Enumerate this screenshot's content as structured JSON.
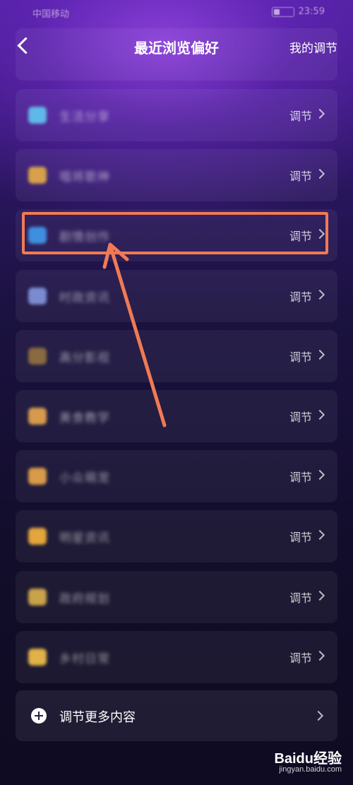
{
  "status_bar": {
    "carrier": "中国移动",
    "time": "23:59"
  },
  "header": {
    "title": "最近浏览偏好",
    "right_action": "我的调节"
  },
  "adjust_label": "调节",
  "categories": [
    {
      "name": "生活分享",
      "icon": "tv-icon",
      "icon_color": "#5fb8e8"
    },
    {
      "name": "唱将歌神",
      "icon": "singer-icon",
      "icon_color": "#d6a14a"
    },
    {
      "name": "剧情创作",
      "icon": "film-icon",
      "icon_color": "#3f8fe0"
    },
    {
      "name": "时政资讯",
      "icon": "satellite-icon",
      "icon_color": "#7a8ccf"
    },
    {
      "name": "高分影视",
      "icon": "film-strip-icon",
      "icon_color": "#8a6a40"
    },
    {
      "name": "美食教学",
      "icon": "food-icon",
      "icon_color": "#d69a4e"
    },
    {
      "name": "小众萌宠",
      "icon": "pet-icon",
      "icon_color": "#d99a4a"
    },
    {
      "name": "明星资讯",
      "icon": "star-person-icon",
      "icon_color": "#e2a63c"
    },
    {
      "name": "政府规划",
      "icon": "government-icon",
      "icon_color": "#c9a24a"
    },
    {
      "name": "乡村日常",
      "icon": "farmer-icon",
      "icon_color": "#e0b247"
    }
  ],
  "more": {
    "label": "调节更多内容"
  },
  "watermark": {
    "logo": "Baidu经验",
    "url": "jingyan.baidu.com"
  },
  "colors": {
    "highlight": "#f07a55"
  }
}
